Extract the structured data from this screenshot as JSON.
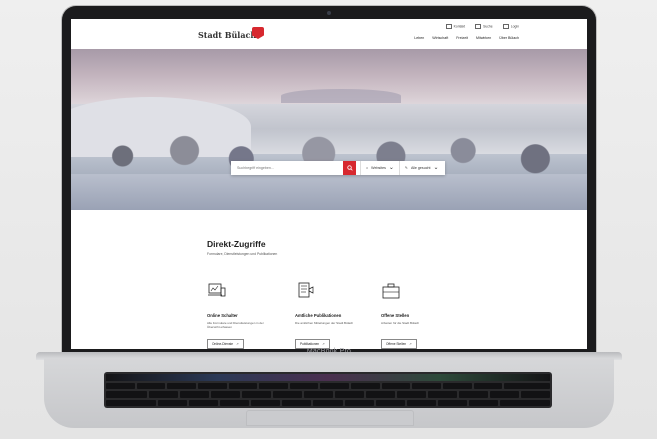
{
  "device": {
    "model_label": "MacBook Pro"
  },
  "site": {
    "logo_text": "Stadt Bülach",
    "utility_links": [
      "Kontakt",
      "Suche",
      "Login"
    ],
    "nav_items": [
      "Leben",
      "Wirtschaft",
      "Freizeit",
      "Mitwirken",
      "Über Bülach"
    ]
  },
  "search": {
    "placeholder": "Suchbegriff eingeben...",
    "filter_websites": "Websites",
    "filter_all": "Alle gesucht"
  },
  "direct_access": {
    "title": "Direkt-Zugriffe",
    "subtitle": "Formulare, Dienstleistungen und Publikationen",
    "cards": [
      {
        "icon": "online-counter-icon",
        "title": "Online Schalter",
        "text": "Alle Formulare und Dienstleistungen in der Übersicht erfassen",
        "button": "Online-Dienste"
      },
      {
        "icon": "publication-icon",
        "title": "Amtliche Publikationen",
        "text": "Die amtlichen Mitteilungen der Stadt Bülach",
        "button": "Publikationen"
      },
      {
        "icon": "briefcase-icon",
        "title": "Offene Stellen",
        "text": "Arbeiten für die Stadt Bülach",
        "button": "Offene Stellen"
      }
    ]
  },
  "colors": {
    "brand_red": "#d7282f"
  }
}
